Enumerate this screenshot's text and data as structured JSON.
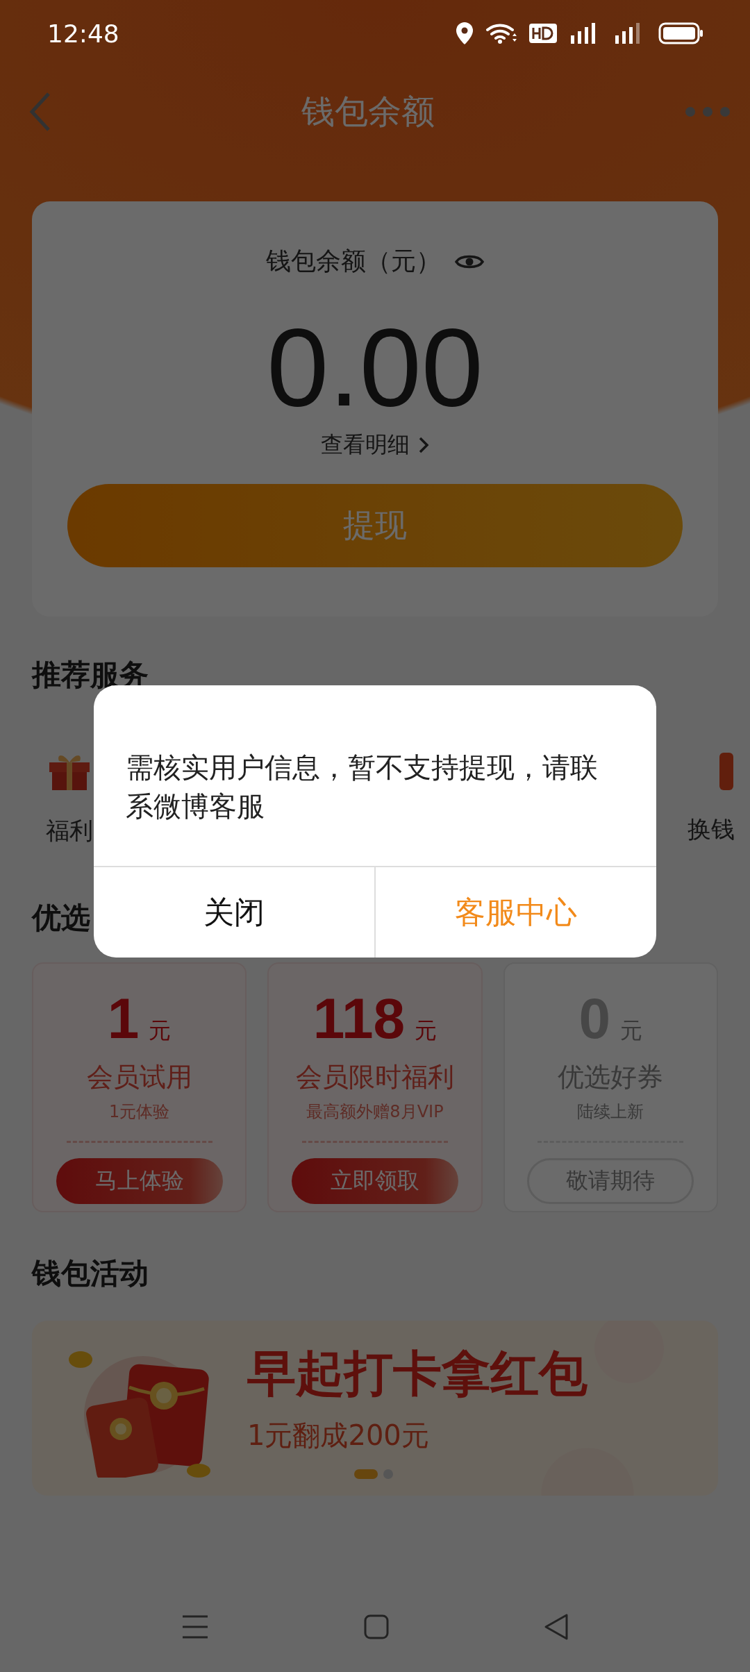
{
  "status_bar": {
    "time": "12:48"
  },
  "nav": {
    "title": "钱包余额"
  },
  "balance": {
    "label": "钱包余额（元）",
    "amount": "0.00",
    "details_link": "查看明细",
    "withdraw_button": "提现"
  },
  "services": {
    "title": "推荐服务",
    "items": [
      {
        "label": "福利"
      },
      {
        "label": "换钱"
      }
    ]
  },
  "coupons": {
    "title": "优选",
    "items": [
      {
        "amount": "1",
        "unit": "元",
        "name": "会员试用",
        "note": "1元体验",
        "button": "马上体验",
        "active": true
      },
      {
        "amount": "118",
        "unit": "元",
        "name": "会员限时福利",
        "note": "最高额外赠8月VIP",
        "button": "立即领取",
        "active": true
      },
      {
        "amount": "0",
        "unit": "元",
        "name": "优选好券",
        "note": "陆续上新",
        "button": "敬请期待",
        "active": false
      }
    ]
  },
  "activities": {
    "title": "钱包活动",
    "banner": {
      "title": "早起打卡拿红包",
      "subtitle": "1元翻成200元",
      "slides": [
        {
          "selected": true
        },
        {
          "selected": false
        }
      ]
    }
  },
  "dialog": {
    "message": "需核实用户信息，暂不支持提现，请联系微博客服",
    "buttons": [
      {
        "label": "关闭",
        "kind": "cancel"
      },
      {
        "label": "客服中心",
        "kind": "primary"
      }
    ]
  }
}
